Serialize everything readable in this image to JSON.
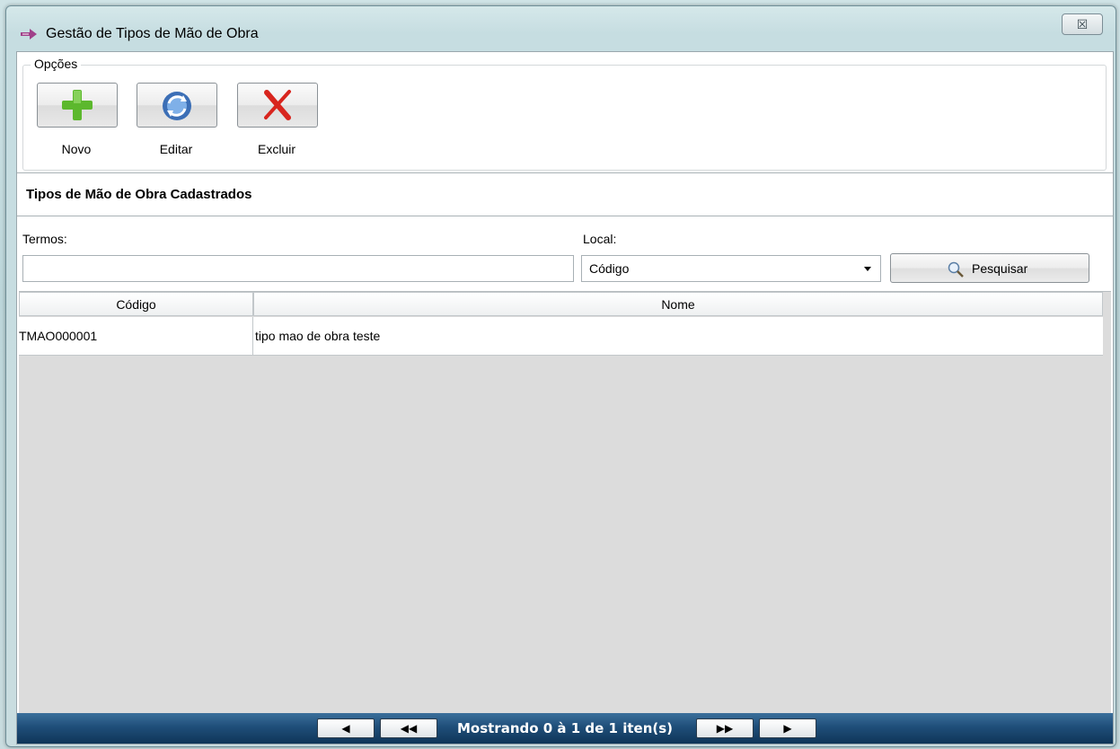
{
  "window": {
    "title": "Gestão de Tipos de Mão de Obra",
    "close_glyph": "☒"
  },
  "options": {
    "legend": "Opções",
    "buttons": [
      {
        "label": "Novo",
        "icon": "plus-icon"
      },
      {
        "label": "Editar",
        "icon": "refresh-icon"
      },
      {
        "label": "Excluir",
        "icon": "delete-x-icon"
      }
    ]
  },
  "section": {
    "title": "Tipos de Mão de Obra Cadastrados"
  },
  "search": {
    "terms_label": "Termos:",
    "terms_value": "",
    "local_label": "Local:",
    "local_selected": "Código",
    "button_label": "Pesquisar"
  },
  "grid": {
    "columns": [
      "Código",
      "Nome"
    ],
    "rows": [
      {
        "codigo": "TMAO000001",
        "nome": "tipo mao de obra teste"
      }
    ]
  },
  "pager": {
    "prev_glyph": "◀",
    "first_glyph": "◀◀",
    "info": "Mostrando 0 à 1 de 1 iten(s)",
    "last_glyph": "▶▶",
    "next_glyph": "▶"
  },
  "colors": {
    "pager_bg": "#1f4e79",
    "plus": "#5cb82d",
    "delete": "#d8251e"
  }
}
